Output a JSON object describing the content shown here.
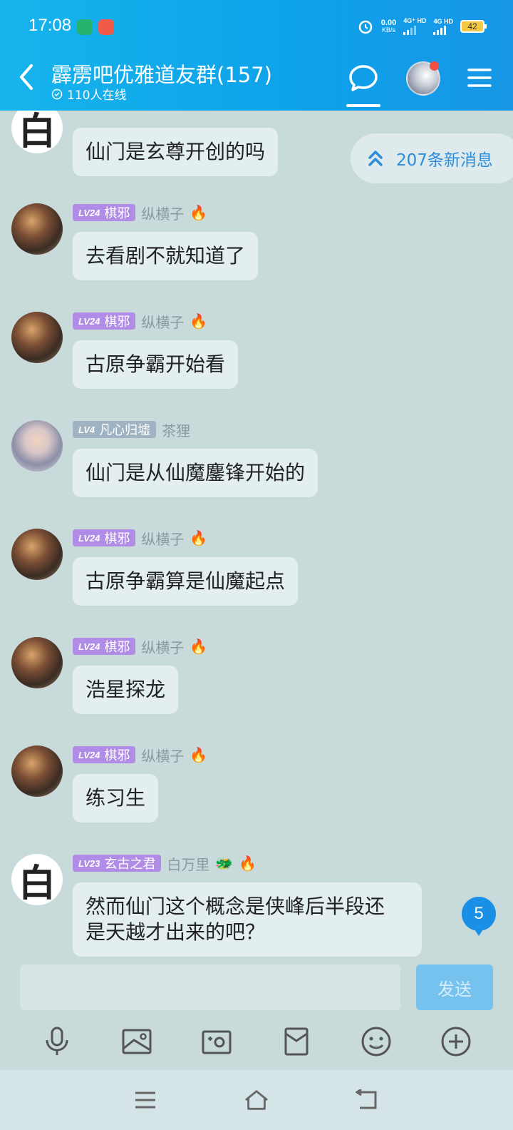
{
  "status_bar": {
    "time": "17:08",
    "net_speed": "0.00",
    "net_unit": "KB/s",
    "sim1": "4G⁺ HD",
    "sim2": "4G HD",
    "battery": "42"
  },
  "header": {
    "title": "霹雳吧优雅道友群(157)",
    "online": "110人在线"
  },
  "new_messages": {
    "label": "207条新消息"
  },
  "messages": [
    {
      "level": "",
      "title": "",
      "nick": "",
      "text": "仙门是玄尊开创的吗"
    },
    {
      "level": "LV24",
      "title": "棋邪",
      "nick": "纵横子",
      "text": "去看剧不就知道了"
    },
    {
      "level": "LV24",
      "title": "棋邪",
      "nick": "纵横子",
      "text": "古原争霸开始看"
    },
    {
      "level": "LV4",
      "title": "凡心归墟",
      "nick": "茶狸",
      "text": "仙门是从仙魔鏖锋开始的"
    },
    {
      "level": "LV24",
      "title": "棋邪",
      "nick": "纵横子",
      "text": "古原争霸算是仙魔起点"
    },
    {
      "level": "LV24",
      "title": "棋邪",
      "nick": "纵横子",
      "text": "浩星探龙"
    },
    {
      "level": "LV24",
      "title": "棋邪",
      "nick": "纵横子",
      "text": "练习生"
    },
    {
      "level": "LV23",
      "title": "玄古之君",
      "nick": "白万里",
      "text_line1": "然而仙门这个概念是侠峰后半段还",
      "text_line2": "是天越才出来的吧？"
    }
  ],
  "avatar_char": "白",
  "unread_count": "5",
  "input": {
    "placeholder": "",
    "send_label": "发送"
  },
  "colors": {
    "header": "#0ea1ea",
    "accent": "#1a8fe6",
    "level_badge": "#b18ce6",
    "background": "#c9dadb"
  },
  "toolbar_icons": [
    "microphone-icon",
    "image-icon",
    "camera-icon",
    "red-packet-icon",
    "emoji-icon",
    "plus-icon"
  ],
  "nav_icons": [
    "menu-icon",
    "home-icon",
    "back-icon"
  ]
}
